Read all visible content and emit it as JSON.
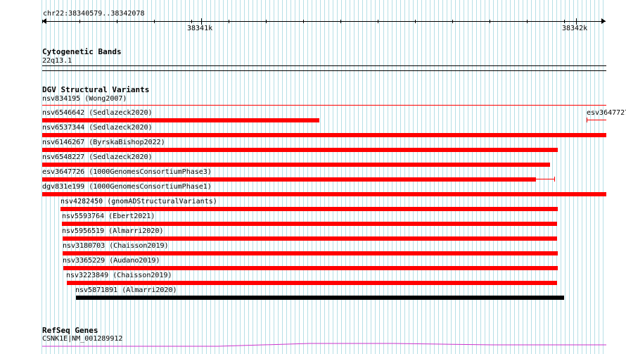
{
  "ruler": {
    "location": "chr22:38340579..38342078",
    "tick_labels": [
      "38341k",
      "38342k"
    ]
  },
  "cytoband": {
    "title": "Cytogenetic Bands",
    "band_label": "22q13.1"
  },
  "dgv": {
    "title": "DGV Structural Variants",
    "features": [
      {
        "label": "nsv834195 (Wong2007)",
        "color": "#ff0000"
      },
      {
        "label": "nsv6546642 (Sedlazeck2020)",
        "color": "#ff0000"
      },
      {
        "label": "nsv6537344 (Sedlazeck2020)",
        "color": "#ff0000"
      },
      {
        "label": "nsv6146267 (ByrskaBishop2022)",
        "color": "#ff0000"
      },
      {
        "label": "nsv6548227 (Sedlazeck2020)",
        "color": "#ff0000"
      },
      {
        "label": "esv3647726 (1000GenomesConsortiumPhase3)",
        "color": "#ff0000"
      },
      {
        "label": "dgv831e199 (1000GenomesConsortiumPhase1)",
        "color": "#ff0000"
      },
      {
        "label": "nsv4282450 (gnomADStructuralVariants)",
        "color": "#ff0000"
      },
      {
        "label": "nsv5593764 (Ebert2021)",
        "color": "#ff0000"
      },
      {
        "label": "nsv5956519 (Almarri2020)",
        "color": "#ff0000"
      },
      {
        "label": "nsv3180703 (Chaisson2019)",
        "color": "#ff0000"
      },
      {
        "label": "nsv3365229 (Audano2019)",
        "color": "#ff0000"
      },
      {
        "label": "nsv3223849 (Chaisson2019)",
        "color": "#ff0000"
      },
      {
        "label": "nsv5871891 (Almarri2020)",
        "color": "#000000"
      }
    ],
    "right_feature_label": "esv3647727"
  },
  "refseq": {
    "title": "RefSeq Genes",
    "gene_label": "CSNK1E|NM_001289912",
    "color": "#cc33cc"
  }
}
